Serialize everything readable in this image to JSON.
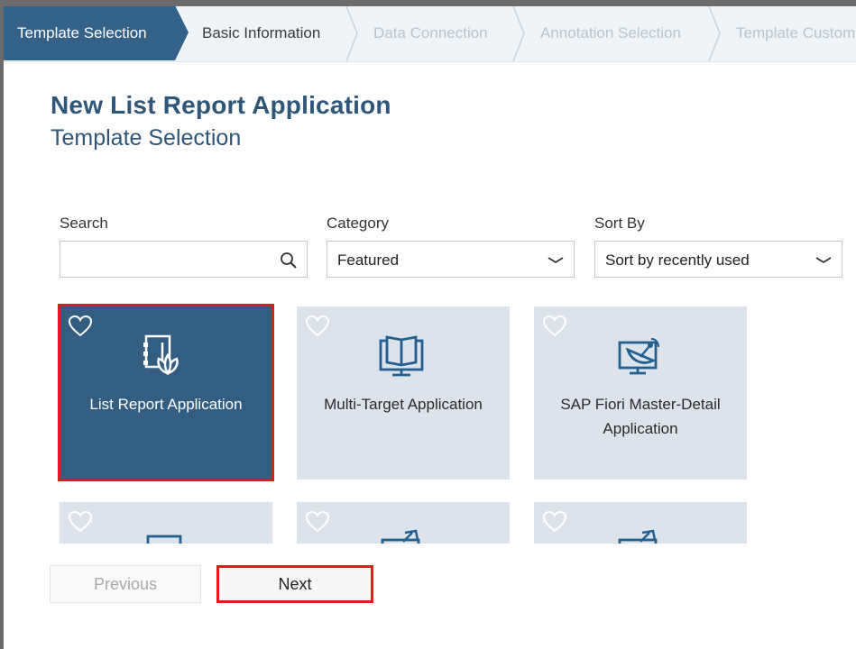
{
  "wizard": {
    "steps": [
      {
        "label": "Template Selection",
        "state": "active"
      },
      {
        "label": "Basic Information",
        "state": "done"
      },
      {
        "label": "Data Connection",
        "state": "disabled"
      },
      {
        "label": "Annotation Selection",
        "state": "disabled"
      },
      {
        "label": "Template Customization",
        "state": "disabled"
      }
    ]
  },
  "header": {
    "title": "New List Report Application",
    "subtitle": "Template Selection"
  },
  "filters": {
    "search": {
      "label": "Search",
      "value": "",
      "placeholder": "",
      "icon": "search-icon"
    },
    "category": {
      "label": "Category",
      "value": "Featured",
      "icon": "chevron-down-icon"
    },
    "sort": {
      "label": "Sort By",
      "value": "Sort by recently used",
      "icon": "chevron-down-icon"
    }
  },
  "templates": [
    {
      "label": "List Report Application",
      "selected": true,
      "icon": "list-report-icon"
    },
    {
      "label": "Multi-Target Application",
      "selected": false,
      "icon": "book-monitor-icon"
    },
    {
      "label": "SAP Fiori Master-Detail Application",
      "selected": false,
      "icon": "satellite-monitor-icon"
    }
  ],
  "templates_row2": [
    {
      "icon": "monitor-icon"
    },
    {
      "icon": "satellite-icon"
    },
    {
      "icon": "satellite-icon"
    }
  ],
  "footer": {
    "previous_label": "Previous",
    "next_label": "Next"
  },
  "colors": {
    "accent": "#346187",
    "tile": "#dce3ea",
    "highlight": "#e31b1b"
  }
}
